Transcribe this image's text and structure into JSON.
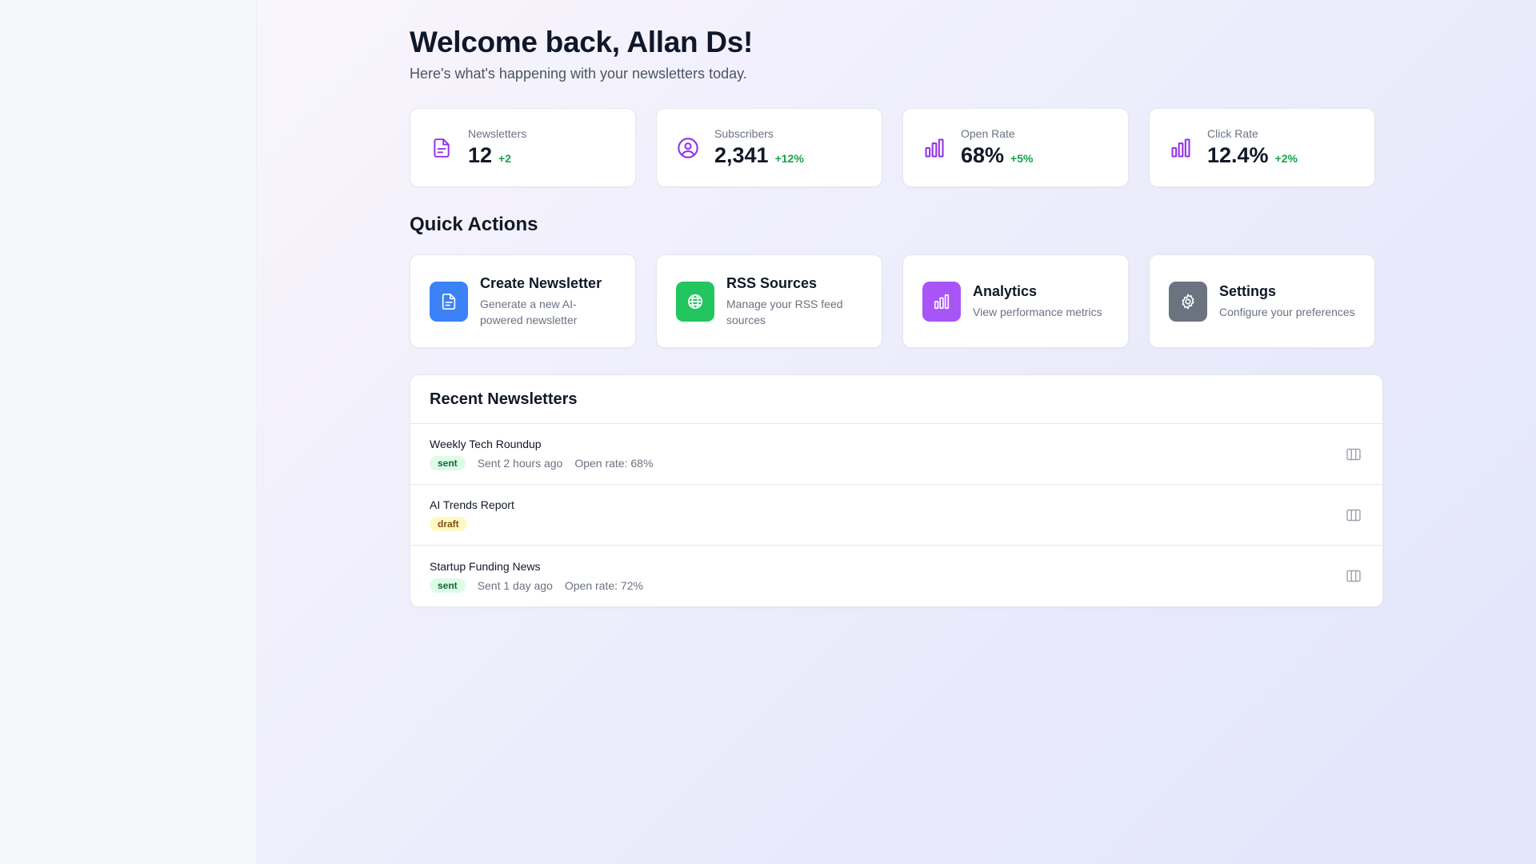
{
  "header": {
    "title": "Welcome back, Allan Ds!",
    "subtitle": "Here's what's happening with your newsletters today."
  },
  "stats": [
    {
      "label": "Newsletters",
      "value": "12",
      "change": "+2",
      "icon": "document-icon"
    },
    {
      "label": "Subscribers",
      "value": "2,341",
      "change": "+12%",
      "icon": "user-circle-icon"
    },
    {
      "label": "Open Rate",
      "value": "68%",
      "change": "+5%",
      "icon": "bar-chart-icon"
    },
    {
      "label": "Click Rate",
      "value": "12.4%",
      "change": "+2%",
      "icon": "bar-chart-icon"
    }
  ],
  "quick_actions": {
    "title": "Quick Actions",
    "items": [
      {
        "title": "Create Newsletter",
        "desc": "Generate a new AI-powered newsletter",
        "icon": "document-icon",
        "color": "#3b82f6"
      },
      {
        "title": "RSS Sources",
        "desc": "Manage your RSS feed sources",
        "icon": "globe-icon",
        "color": "#22c55e"
      },
      {
        "title": "Analytics",
        "desc": "View performance metrics",
        "icon": "bar-chart-icon",
        "color": "#a855f7"
      },
      {
        "title": "Settings",
        "desc": "Configure your preferences",
        "icon": "gear-icon",
        "color": "#6b7280"
      }
    ]
  },
  "recent": {
    "title": "Recent Newsletters",
    "items": [
      {
        "title": "Weekly Tech Roundup",
        "status": "sent",
        "sent": "Sent 2 hours ago",
        "open_rate": "Open rate: 68%"
      },
      {
        "title": "AI Trends Report",
        "status": "draft",
        "sent": "",
        "open_rate": ""
      },
      {
        "title": "Startup Funding News",
        "status": "sent",
        "sent": "Sent 1 day ago",
        "open_rate": "Open rate: 72%"
      }
    ]
  },
  "colors": {
    "accent_purple": "#9333ea",
    "positive": "#16a34a"
  }
}
